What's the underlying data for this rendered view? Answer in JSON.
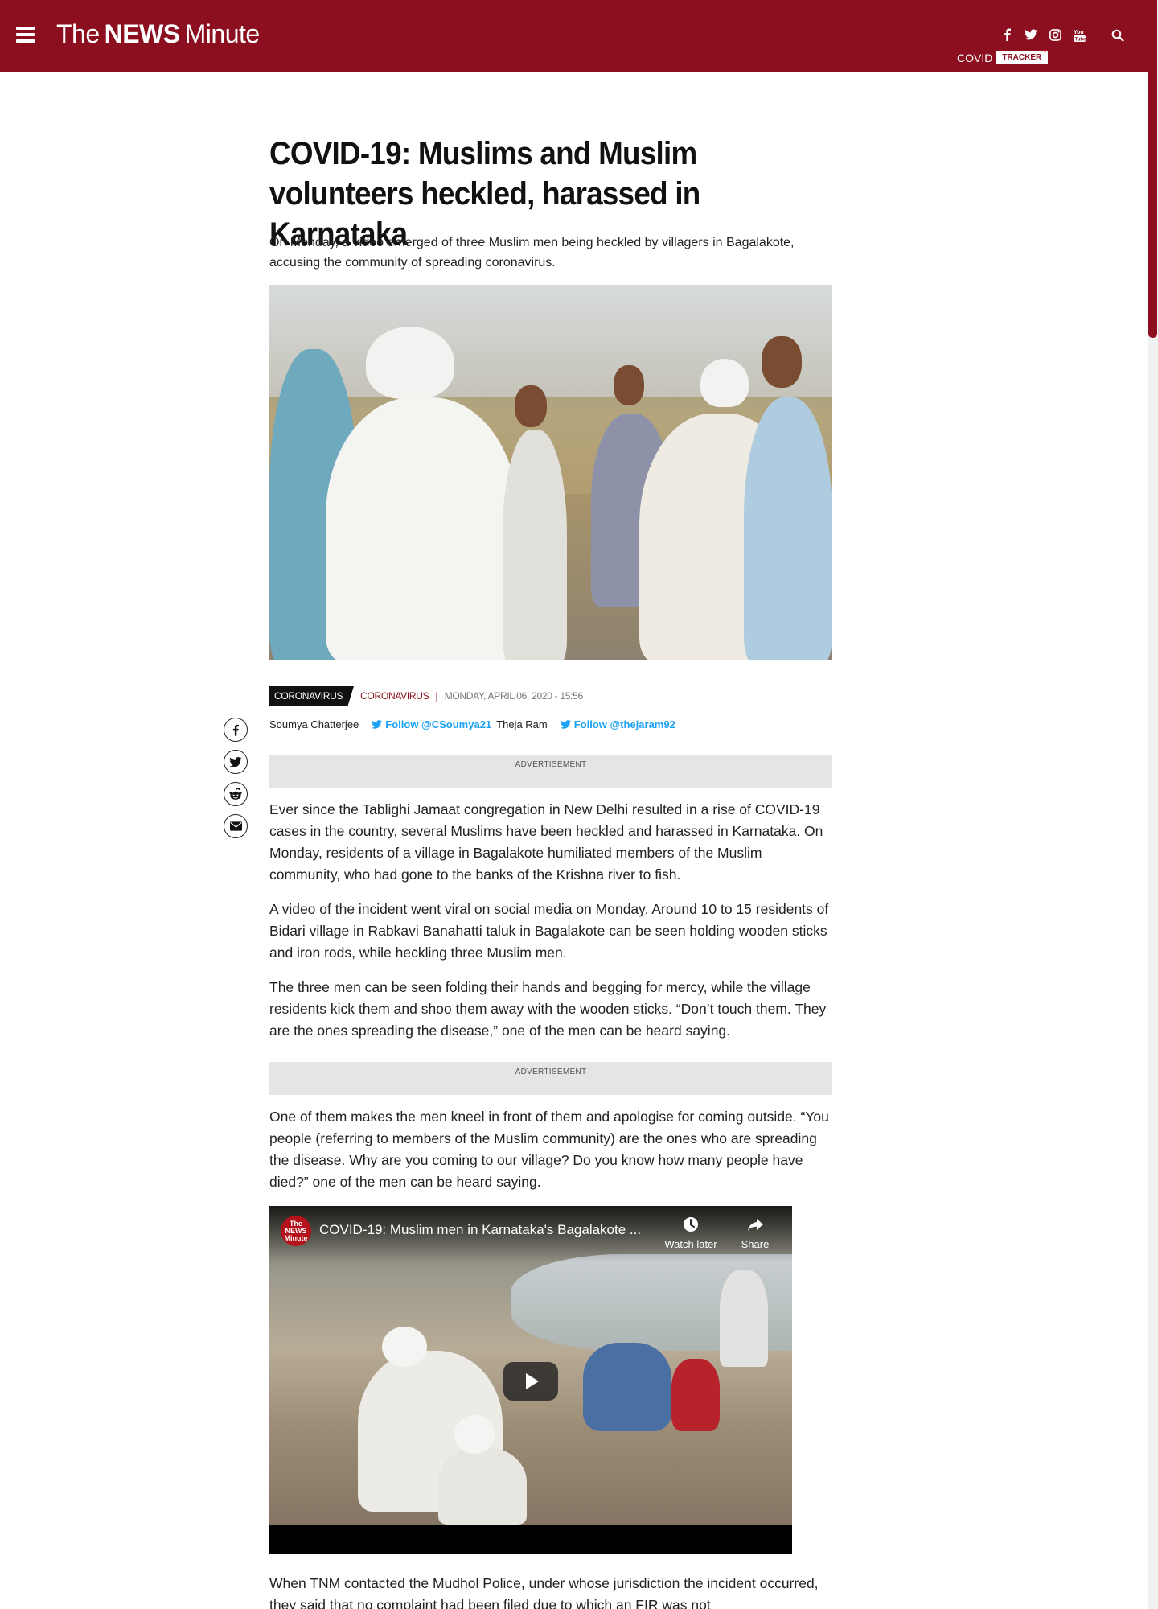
{
  "header": {
    "logo": {
      "part1": "The",
      "part2": "NEWS",
      "part3": "Minute"
    },
    "social_icons": [
      "facebook-icon",
      "twitter-icon",
      "instagram-icon",
      "youtube-icon"
    ],
    "covid_label": "COVID",
    "tracker_label": "TRACKER"
  },
  "article": {
    "title": "COVID-19: Muslims and Muslim volunteers heckled, harassed in Karnataka",
    "summary": "On Monday, a video emerged of three Muslim men being heckled by villagers in Bagalakote, accusing the community of spreading coronavirus.",
    "tag": "CORONAVIRUS",
    "category": "CORONAVIRUS",
    "separator": "|",
    "date": "MONDAY, APRIL 06, 2020 - 15:56",
    "authors": [
      {
        "name": "Soumya Chatterjee",
        "follow": "Follow @CSoumya21"
      },
      {
        "name": "Theja Ram",
        "follow": "Follow @thejaram92"
      }
    ],
    "ad_label": "ADVERTISEMENT",
    "paragraphs": [
      "Ever since the Tablighi Jamaat congregation in New Delhi resulted in a rise of COVID-19 cases in the country, several Muslims have been heckled and harassed in Karnataka. On Monday, residents of a village in Bagalakote humiliated members of the Muslim community, who had gone to the banks of the Krishna river to fish.",
      "A video of the incident went viral on social media on Monday. Around 10 to 15 residents of Bidari village in Rabkavi Banahatti taluk in Bagalakote can be seen holding wooden sticks and iron rods, while heckling three Muslim men.",
      "The three men can be seen folding their hands and begging for mercy, while the village residents kick them and shoo them away with the wooden sticks. “Don’t touch them. They are the ones spreading the disease,” one of the men can be heard saying.",
      "One of them makes the men kneel in front of them and apologise for coming outside. “You people (referring to members of the Muslim community) are the ones who are spreading the disease. Why are you coming to our village? Do you know how many people have died?” one of the men can be heard saying.",
      "When TNM contacted the Mudhol Police, under whose jurisdiction the incident occurred, they said that no complaint had been filed due to which an FIR was not"
    ],
    "video": {
      "channel_logo": "The NEWS Minute",
      "title": "COVID-19: Muslim men in Karnataka's Bagalakote ...",
      "watch_later": "Watch later",
      "share": "Share"
    }
  },
  "share_icons": [
    "facebook-icon",
    "twitter-icon",
    "reddit-icon",
    "email-icon"
  ],
  "colors": {
    "brand": "#8b0f1f",
    "twitter": "#1da1f2"
  }
}
